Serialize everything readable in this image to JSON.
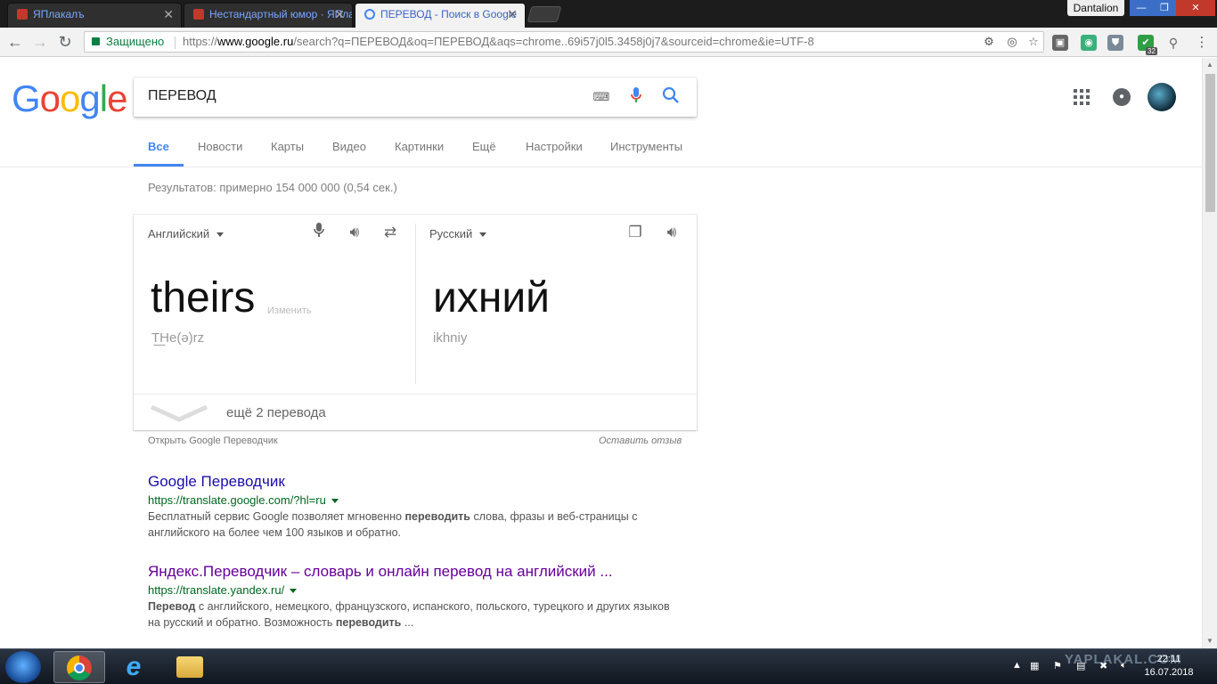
{
  "browser": {
    "tabs": [
      {
        "title": "ЯПлакалъ",
        "favicon": "yaplakal-icon"
      },
      {
        "title": "Нестандартный юмор · ЯПлакалъ",
        "favicon": "yaplakal-icon"
      },
      {
        "title": "ПЕРЕВОД - Поиск в Google",
        "favicon": "google-icon"
      }
    ],
    "user_name": "Dantalion",
    "secure_label": "Защищено",
    "url_scheme": "https://",
    "url_host": "www.google.ru",
    "url_rest": "/search?q=ПЕРЕВОД&oq=ПЕРЕВОД&aqs=chrome..69i57j0l5.3458j0j7&sourceid=chrome&ie=UTF-8",
    "extension_badge": "32"
  },
  "google": {
    "logo_letters": [
      "G",
      "o",
      "o",
      "g",
      "l",
      "e"
    ],
    "logo_colors": [
      "#4285F4",
      "#EA4335",
      "#FBBC05",
      "#4285F4",
      "#34A853",
      "#EA4335"
    ],
    "query": "ПЕРЕВОД",
    "tabs": [
      "Все",
      "Новости",
      "Карты",
      "Видео",
      "Картинки",
      "Ещё",
      "Настройки",
      "Инструменты"
    ],
    "stats": "Результатов: примерно 154 000 000 (0,54 сек.)"
  },
  "translator": {
    "source_lang": "Английский",
    "target_lang": "Русский",
    "source_word": "theirs",
    "edit_label": "Изменить",
    "source_translit": "T͟He(ə)rz",
    "target_word": "ихний",
    "target_translit": "ikhniy",
    "more_label": "ещё 2 перевода",
    "open_link": "Открыть Google Переводчик",
    "feedback_link": "Оставить отзыв"
  },
  "results": [
    {
      "title": "Google Переводчик",
      "url": "https://translate.google.com/?hl=ru",
      "desc_parts": [
        "Бесплатный сервис Google позволяет мгновенно ",
        "переводить",
        " слова, фразы и веб-страницы с английского на более чем 100 языков и обратно."
      ]
    },
    {
      "title": "Яндекс.Переводчик – словарь и онлайн перевод на английский ...",
      "url": "https://translate.yandex.ru/",
      "desc_parts": [
        "Перевод",
        " с английского, немецкого, французского, испанского, польского, турецкого и других языков на русский и обратно. Возможность ",
        "переводить",
        " ..."
      ]
    }
  ],
  "taskbar": {
    "time": "22:11",
    "date": "16.07.2018",
    "watermark": "YAPLAKAL.COM"
  }
}
